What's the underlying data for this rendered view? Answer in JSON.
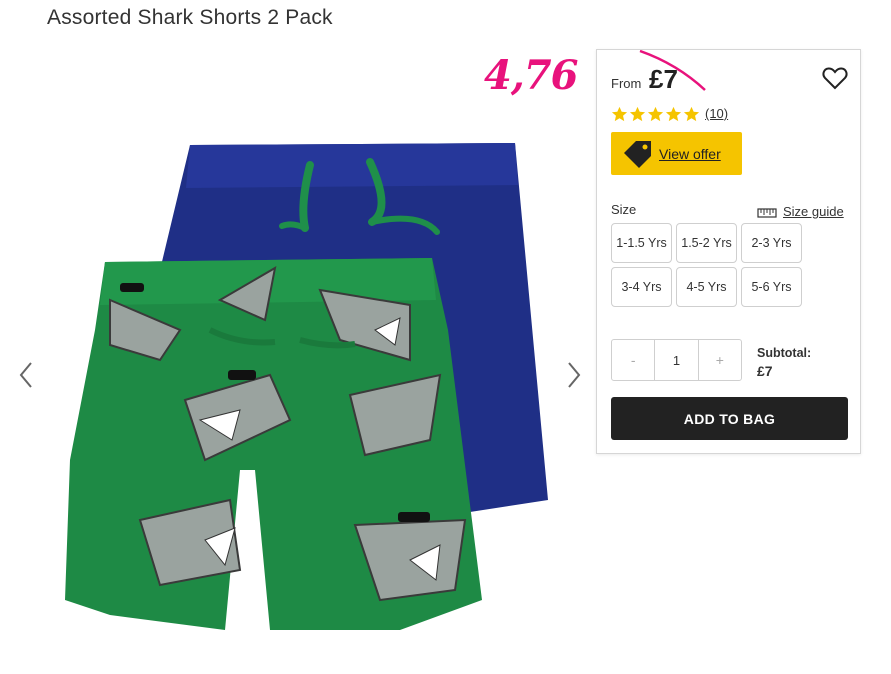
{
  "product": {
    "title": "Assorted Shark Shorts 2 Pack",
    "from_label": "From",
    "price": "£7",
    "promo_price": "4,76",
    "rating": 5,
    "reviews": "(10)",
    "offer_label": "View offer",
    "size_label": "Size",
    "size_guide_label": "Size guide",
    "sizes": [
      "1-1.5 Yrs",
      "1.5-2 Yrs",
      "2-3 Yrs",
      "3-4 Yrs",
      "4-5 Yrs",
      "5-6 Yrs"
    ],
    "quantity": "1",
    "minus": "-",
    "plus": "+",
    "subtotal_label": "Subtotal:",
    "subtotal_value": "£7",
    "add_to_bag": "ADD TO BAG"
  },
  "colors": {
    "promo": "#e8127c",
    "offer_button": "#f5c400",
    "add_button": "#222222",
    "stars": "#f5c400",
    "navy_shorts": "#1f2f86",
    "green_shorts": "#1e8a45"
  },
  "icons": [
    "chevron-left-icon",
    "chevron-right-icon",
    "heart-icon",
    "star-icon",
    "tag-icon",
    "ruler-icon"
  ]
}
